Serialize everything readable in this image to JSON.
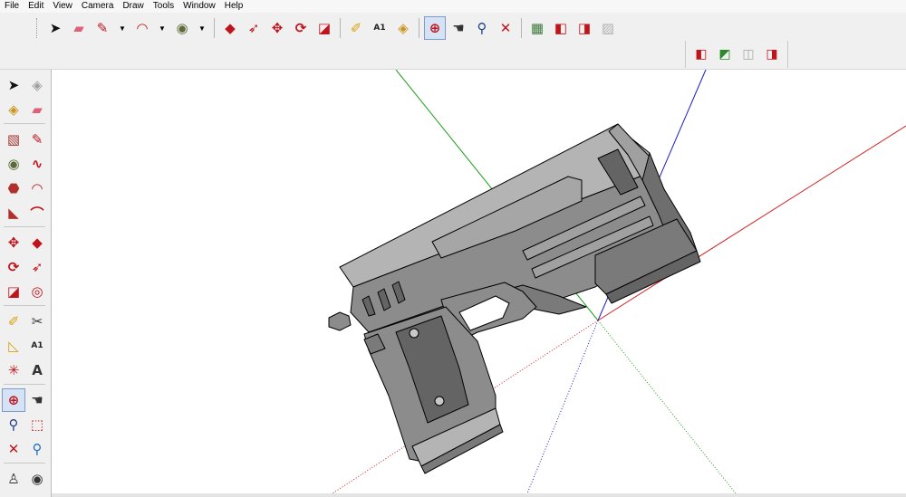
{
  "menu": [
    "File",
    "Edit",
    "View",
    "Camera",
    "Draw",
    "Tools",
    "Window",
    "Help"
  ],
  "toolbar_main": [
    {
      "name": "select-tool-button",
      "icon": "arrow-cursor-icon",
      "glyph": "➤",
      "color": "#111111"
    },
    {
      "name": "eraser-button",
      "icon": "eraser-icon",
      "glyph": "▰",
      "color": "#e0607a"
    },
    {
      "name": "pencil-button",
      "icon": "pencil-icon",
      "glyph": "✎",
      "color": "#c0141c",
      "dropdown": true
    },
    {
      "name": "arc-button",
      "icon": "arc-icon",
      "glyph": "◠",
      "color": "#c0141c",
      "dropdown": true
    },
    {
      "name": "circle-button",
      "icon": "circle-icon",
      "glyph": "◉",
      "color": "#5c6b3a",
      "dropdown": true
    },
    {
      "name": "push-pull-button",
      "icon": "push-pull-icon",
      "glyph": "◆",
      "color": "#c0141c",
      "sep": true
    },
    {
      "name": "follow-me-button",
      "icon": "follow-me-icon",
      "glyph": "➶",
      "color": "#c0141c"
    },
    {
      "name": "move-button",
      "icon": "move-icon",
      "glyph": "✥",
      "color": "#c0141c"
    },
    {
      "name": "rotate-button",
      "icon": "rotate-icon",
      "glyph": "⟳",
      "color": "#c0141c"
    },
    {
      "name": "scale-button",
      "icon": "scale-icon",
      "glyph": "◪",
      "color": "#c0141c"
    },
    {
      "name": "tape-measure-button",
      "icon": "tape-measure-icon",
      "glyph": "✐",
      "color": "#d9a20c",
      "sep": true
    },
    {
      "name": "text-button",
      "icon": "text-icon",
      "glyph": "A1",
      "color": "#222222"
    },
    {
      "name": "paint-bucket-button",
      "icon": "paint-bucket-icon",
      "glyph": "◈",
      "color": "#c8961e"
    },
    {
      "name": "orbit-button",
      "icon": "orbit-icon",
      "glyph": "⊕",
      "color": "#c0141c",
      "active": true,
      "sep": true
    },
    {
      "name": "pan-button",
      "icon": "pan-hand-icon",
      "glyph": "☚",
      "color": "#333333"
    },
    {
      "name": "zoom-button",
      "icon": "zoom-icon",
      "glyph": "⚲",
      "color": "#1f3f8c"
    },
    {
      "name": "zoom-extents-button",
      "icon": "zoom-extents-icon",
      "glyph": "✕",
      "color": "#c0141c"
    },
    {
      "name": "warehouse-button",
      "icon": "warehouse-icon",
      "glyph": "▦",
      "color": "#3b7a3b",
      "sep": true
    },
    {
      "name": "get-models-button",
      "icon": "get-models-icon",
      "glyph": "◧",
      "color": "#c0141c"
    },
    {
      "name": "share-model-button",
      "icon": "share-model-icon",
      "glyph": "◨",
      "color": "#c0141c"
    },
    {
      "name": "extension-warehouse-button",
      "icon": "extension-icon",
      "glyph": "▨",
      "color": "#b0b0b0"
    }
  ],
  "toolbar_second": [
    {
      "name": "warehouse-get-button",
      "icon": "get-model-icon",
      "glyph": "◧",
      "color": "#c0141c"
    },
    {
      "name": "warehouse-upload-button",
      "icon": "upload-model-icon",
      "glyph": "◩",
      "color": "#2c8a2c"
    },
    {
      "name": "warehouse-disabled-button",
      "icon": "share-component-icon",
      "glyph": "◫",
      "color": "#a8a8a8"
    },
    {
      "name": "warehouse-share-button",
      "icon": "share-icon",
      "glyph": "◨",
      "color": "#c0141c"
    }
  ],
  "left_tools": [
    [
      {
        "name": "select-tool",
        "icon": "arrow-cursor-icon",
        "glyph": "➤",
        "color": "#111111"
      },
      {
        "name": "make-component",
        "icon": "component-icon",
        "glyph": "◈",
        "color": "#a0a0a0"
      }
    ],
    [
      {
        "name": "paint-bucket",
        "icon": "paint-bucket-icon",
        "glyph": "◈",
        "color": "#c8961e"
      },
      {
        "name": "eraser",
        "icon": "eraser-icon",
        "glyph": "▰",
        "color": "#e0607a"
      }
    ],
    [
      {
        "name": "rectangle",
        "icon": "rectangle-icon",
        "glyph": "▧",
        "color": "#b0302e",
        "sepBefore": true
      },
      {
        "name": "line",
        "icon": "pencil-icon",
        "glyph": "✎",
        "color": "#c0141c"
      }
    ],
    [
      {
        "name": "circle",
        "icon": "circle-icon",
        "glyph": "◉",
        "color": "#5c6b3a"
      },
      {
        "name": "freehand",
        "icon": "freehand-icon",
        "glyph": "∿",
        "color": "#c0141c"
      }
    ],
    [
      {
        "name": "polygon",
        "icon": "polygon-icon",
        "glyph": "⬣",
        "color": "#b0302e"
      },
      {
        "name": "arc",
        "icon": "arc-icon",
        "glyph": "◠",
        "color": "#c0141c"
      }
    ],
    [
      {
        "name": "pie",
        "icon": "pie-icon",
        "glyph": "◣",
        "color": "#b0302e"
      },
      {
        "name": "two-point-arc",
        "icon": "two-point-arc-icon",
        "glyph": "⌒",
        "color": "#c0141c"
      }
    ],
    [
      {
        "name": "move",
        "icon": "move-icon",
        "glyph": "✥",
        "color": "#c0141c",
        "sepBefore": true
      },
      {
        "name": "push-pull",
        "icon": "push-pull-icon",
        "glyph": "◆",
        "color": "#c0141c"
      }
    ],
    [
      {
        "name": "rotate",
        "icon": "rotate-icon",
        "glyph": "⟳",
        "color": "#c0141c"
      },
      {
        "name": "follow-me",
        "icon": "follow-me-icon",
        "glyph": "➶",
        "color": "#c0141c"
      }
    ],
    [
      {
        "name": "scale",
        "icon": "scale-icon",
        "glyph": "◪",
        "color": "#c0141c"
      },
      {
        "name": "offset",
        "icon": "offset-icon",
        "glyph": "◎",
        "color": "#c0141c"
      }
    ],
    [
      {
        "name": "tape-measure",
        "icon": "tape-measure-icon",
        "glyph": "✐",
        "color": "#d9a20c",
        "sepBefore": true
      },
      {
        "name": "dimension",
        "icon": "dimension-icon",
        "glyph": "✂",
        "color": "#333333"
      }
    ],
    [
      {
        "name": "protractor",
        "icon": "protractor-icon",
        "glyph": "◺",
        "color": "#d9a20c"
      },
      {
        "name": "text",
        "icon": "text-icon",
        "glyph": "A1",
        "color": "#222222"
      }
    ],
    [
      {
        "name": "axes",
        "icon": "axes-icon",
        "glyph": "✳",
        "color": "#c0141c"
      },
      {
        "name": "3d-text",
        "icon": "3d-text-icon",
        "glyph": "A",
        "color": "#333333"
      }
    ],
    [
      {
        "name": "orbit",
        "icon": "orbit-icon",
        "glyph": "⊕",
        "color": "#c0141c",
        "active": true,
        "sepBefore": true
      },
      {
        "name": "pan",
        "icon": "pan-hand-icon",
        "glyph": "☚",
        "color": "#333333"
      }
    ],
    [
      {
        "name": "zoom",
        "icon": "zoom-icon",
        "glyph": "⚲",
        "color": "#1f3f8c"
      },
      {
        "name": "zoom-window",
        "icon": "zoom-window-icon",
        "glyph": "⬚",
        "color": "#c0141c"
      }
    ],
    [
      {
        "name": "zoom-extents",
        "icon": "zoom-extents-icon",
        "glyph": "✕",
        "color": "#c0141c"
      },
      {
        "name": "previous-view",
        "icon": "previous-view-icon",
        "glyph": "⚲",
        "color": "#1f6ec0"
      }
    ],
    [
      {
        "name": "position-camera",
        "icon": "position-camera-icon",
        "glyph": "♙",
        "color": "#333333",
        "sepBefore": true
      },
      {
        "name": "look-around",
        "icon": "eye-icon",
        "glyph": "◉",
        "color": "#333333"
      }
    ]
  ],
  "colors": {
    "axis_red": "#d22020",
    "axis_green": "#1a9e1a",
    "axis_blue": "#1c1ccc",
    "model_mid": "#8c8c8c",
    "model_light": "#b4b4b4",
    "model_dark": "#646464"
  }
}
